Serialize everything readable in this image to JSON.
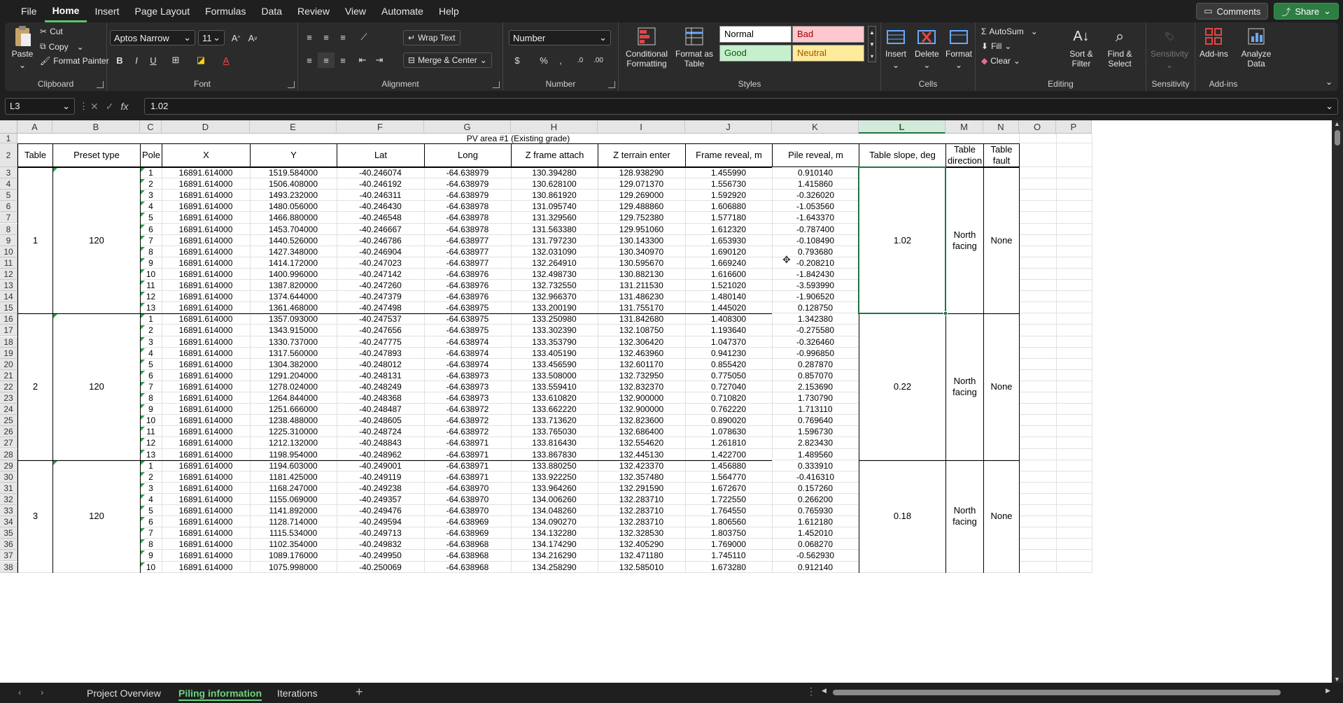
{
  "menu": [
    "File",
    "Home",
    "Insert",
    "Page Layout",
    "Formulas",
    "Data",
    "Review",
    "View",
    "Automate",
    "Help"
  ],
  "active_menu": "Home",
  "top_buttons": {
    "comments": "Comments",
    "share": "Share"
  },
  "ribbon": {
    "clipboard": {
      "label": "Clipboard",
      "paste": "Paste",
      "cut": "Cut",
      "copy": "Copy",
      "format_painter": "Format Painter"
    },
    "font": {
      "label": "Font",
      "name": "Aptos Narrow",
      "size": "11"
    },
    "alignment": {
      "label": "Alignment",
      "wrap": "Wrap Text",
      "merge": "Merge & Center"
    },
    "number": {
      "label": "Number",
      "format": "Number"
    },
    "styles": {
      "label": "Styles",
      "conditional": "Conditional Formatting",
      "format_table": "Format as Table",
      "normal": "Normal",
      "bad": "Bad",
      "good": "Good",
      "neutral": "Neutral"
    },
    "cells": {
      "label": "Cells",
      "insert": "Insert",
      "delete": "Delete",
      "format": "Format"
    },
    "editing": {
      "label": "Editing",
      "autosum": "AutoSum",
      "fill": "Fill",
      "clear": "Clear",
      "sort": "Sort & Filter",
      "find": "Find & Select"
    },
    "sensitivity": {
      "label": "Sensitivity",
      "btn": "Sensitivity"
    },
    "addins": {
      "label": "Add-ins",
      "btn": "Add-ins",
      "analyze": "Analyze Data"
    }
  },
  "formula_bar": {
    "name_box": "L3",
    "value": "1.02"
  },
  "columns": [
    "A",
    "B",
    "C",
    "D",
    "E",
    "F",
    "G",
    "H",
    "I",
    "J",
    "K",
    "L",
    "M",
    "N",
    "O",
    "P"
  ],
  "selected_column": "L",
  "sheet_title": "PV area #1 (Existing grade)",
  "headers": [
    "Table",
    "Preset type",
    "Pole",
    "X",
    "Y",
    "Lat",
    "Long",
    "Z frame attach",
    "Z terrain enter",
    "Frame reveal, m",
    "Pile reveal, m",
    "Table slope, deg",
    "Table direction",
    "Table fault"
  ],
  "tables": [
    {
      "table": "1",
      "preset": "120",
      "slope": "1.02",
      "direction": "North facing",
      "fault": "None"
    },
    {
      "table": "2",
      "preset": "120",
      "slope": "0.22",
      "direction": "North facing",
      "fault": "None"
    },
    {
      "table": "3",
      "preset": "120",
      "slope": "0.18",
      "direction": "North facing",
      "fault": "None"
    }
  ],
  "rows": [
    [
      "1",
      "16891.614000",
      "1519.584000",
      "-40.246074",
      "-64.638979",
      "130.394280",
      "128.938290",
      "1.455990",
      "0.910140"
    ],
    [
      "2",
      "16891.614000",
      "1506.408000",
      "-40.246192",
      "-64.638979",
      "130.628100",
      "129.071370",
      "1.556730",
      "1.415860"
    ],
    [
      "3",
      "16891.614000",
      "1493.232000",
      "-40.246311",
      "-64.638979",
      "130.861920",
      "129.269000",
      "1.592920",
      "-0.326020"
    ],
    [
      "4",
      "16891.614000",
      "1480.056000",
      "-40.246430",
      "-64.638978",
      "131.095740",
      "129.488860",
      "1.606880",
      "-1.053560"
    ],
    [
      "5",
      "16891.614000",
      "1466.880000",
      "-40.246548",
      "-64.638978",
      "131.329560",
      "129.752380",
      "1.577180",
      "-1.643370"
    ],
    [
      "6",
      "16891.614000",
      "1453.704000",
      "-40.246667",
      "-64.638978",
      "131.563380",
      "129.951060",
      "1.612320",
      "-0.787400"
    ],
    [
      "7",
      "16891.614000",
      "1440.526000",
      "-40.246786",
      "-64.638977",
      "131.797230",
      "130.143300",
      "1.653930",
      "-0.108490"
    ],
    [
      "8",
      "16891.614000",
      "1427.348000",
      "-40.246904",
      "-64.638977",
      "132.031090",
      "130.340970",
      "1.690120",
      "0.793680"
    ],
    [
      "9",
      "16891.614000",
      "1414.172000",
      "-40.247023",
      "-64.638977",
      "132.264910",
      "130.595670",
      "1.669240",
      "-0.208210"
    ],
    [
      "10",
      "16891.614000",
      "1400.996000",
      "-40.247142",
      "-64.638976",
      "132.498730",
      "130.882130",
      "1.616600",
      "-1.842430"
    ],
    [
      "11",
      "16891.614000",
      "1387.820000",
      "-40.247260",
      "-64.638976",
      "132.732550",
      "131.211530",
      "1.521020",
      "-3.593990"
    ],
    [
      "12",
      "16891.614000",
      "1374.644000",
      "-40.247379",
      "-64.638976",
      "132.966370",
      "131.486230",
      "1.480140",
      "-1.906520"
    ],
    [
      "13",
      "16891.614000",
      "1361.468000",
      "-40.247498",
      "-64.638975",
      "133.200190",
      "131.755170",
      "1.445020",
      "0.128750"
    ],
    [
      "1",
      "16891.614000",
      "1357.093000",
      "-40.247537",
      "-64.638975",
      "133.250980",
      "131.842680",
      "1.408300",
      "1.342380"
    ],
    [
      "2",
      "16891.614000",
      "1343.915000",
      "-40.247656",
      "-64.638975",
      "133.302390",
      "132.108750",
      "1.193640",
      "-0.275580"
    ],
    [
      "3",
      "16891.614000",
      "1330.737000",
      "-40.247775",
      "-64.638974",
      "133.353790",
      "132.306420",
      "1.047370",
      "-0.326460"
    ],
    [
      "4",
      "16891.614000",
      "1317.560000",
      "-40.247893",
      "-64.638974",
      "133.405190",
      "132.463960",
      "0.941230",
      "-0.996850"
    ],
    [
      "5",
      "16891.614000",
      "1304.382000",
      "-40.248012",
      "-64.638974",
      "133.456590",
      "132.601170",
      "0.855420",
      "0.287870"
    ],
    [
      "6",
      "16891.614000",
      "1291.204000",
      "-40.248131",
      "-64.638973",
      "133.508000",
      "132.732950",
      "0.775050",
      "0.857070"
    ],
    [
      "7",
      "16891.614000",
      "1278.024000",
      "-40.248249",
      "-64.638973",
      "133.559410",
      "132.832370",
      "0.727040",
      "2.153690"
    ],
    [
      "8",
      "16891.614000",
      "1264.844000",
      "-40.248368",
      "-64.638973",
      "133.610820",
      "132.900000",
      "0.710820",
      "1.730790"
    ],
    [
      "9",
      "16891.614000",
      "1251.666000",
      "-40.248487",
      "-64.638972",
      "133.662220",
      "132.900000",
      "0.762220",
      "1.713110"
    ],
    [
      "10",
      "16891.614000",
      "1238.488000",
      "-40.248605",
      "-64.638972",
      "133.713620",
      "132.823600",
      "0.890020",
      "0.769640"
    ],
    [
      "11",
      "16891.614000",
      "1225.310000",
      "-40.248724",
      "-64.638972",
      "133.765030",
      "132.686400",
      "1.078630",
      "1.596730"
    ],
    [
      "12",
      "16891.614000",
      "1212.132000",
      "-40.248843",
      "-64.638971",
      "133.816430",
      "132.554620",
      "1.261810",
      "2.823430"
    ],
    [
      "13",
      "16891.614000",
      "1198.954000",
      "-40.248962",
      "-64.638971",
      "133.867830",
      "132.445130",
      "1.422700",
      "1.489560"
    ],
    [
      "1",
      "16891.614000",
      "1194.603000",
      "-40.249001",
      "-64.638971",
      "133.880250",
      "132.423370",
      "1.456880",
      "0.333910"
    ],
    [
      "2",
      "16891.614000",
      "1181.425000",
      "-40.249119",
      "-64.638971",
      "133.922250",
      "132.357480",
      "1.564770",
      "-0.416310"
    ],
    [
      "3",
      "16891.614000",
      "1168.247000",
      "-40.249238",
      "-64.638970",
      "133.964260",
      "132.291590",
      "1.672670",
      "0.157260"
    ],
    [
      "4",
      "16891.614000",
      "1155.069000",
      "-40.249357",
      "-64.638970",
      "134.006260",
      "132.283710",
      "1.722550",
      "0.266200"
    ],
    [
      "5",
      "16891.614000",
      "1141.892000",
      "-40.249476",
      "-64.638970",
      "134.048260",
      "132.283710",
      "1.764550",
      "0.765930"
    ],
    [
      "6",
      "16891.614000",
      "1128.714000",
      "-40.249594",
      "-64.638969",
      "134.090270",
      "132.283710",
      "1.806560",
      "1.612180"
    ],
    [
      "7",
      "16891.614000",
      "1115.534000",
      "-40.249713",
      "-64.638969",
      "134.132280",
      "132.328530",
      "1.803750",
      "1.452010"
    ],
    [
      "8",
      "16891.614000",
      "1102.354000",
      "-40.249832",
      "-64.638968",
      "134.174290",
      "132.405290",
      "1.769000",
      "0.068270"
    ],
    [
      "9",
      "16891.614000",
      "1089.176000",
      "-40.249950",
      "-64.638968",
      "134.216290",
      "132.471180",
      "1.745110",
      "-0.562930"
    ],
    [
      "10",
      "16891.614000",
      "1075.998000",
      "-40.250069",
      "-64.638968",
      "134.258290",
      "132.585010",
      "1.673280",
      "0.912140"
    ]
  ],
  "sheet_tabs": [
    "Project Overview",
    "Piling information",
    "Iterations"
  ],
  "active_tab": "Piling information"
}
